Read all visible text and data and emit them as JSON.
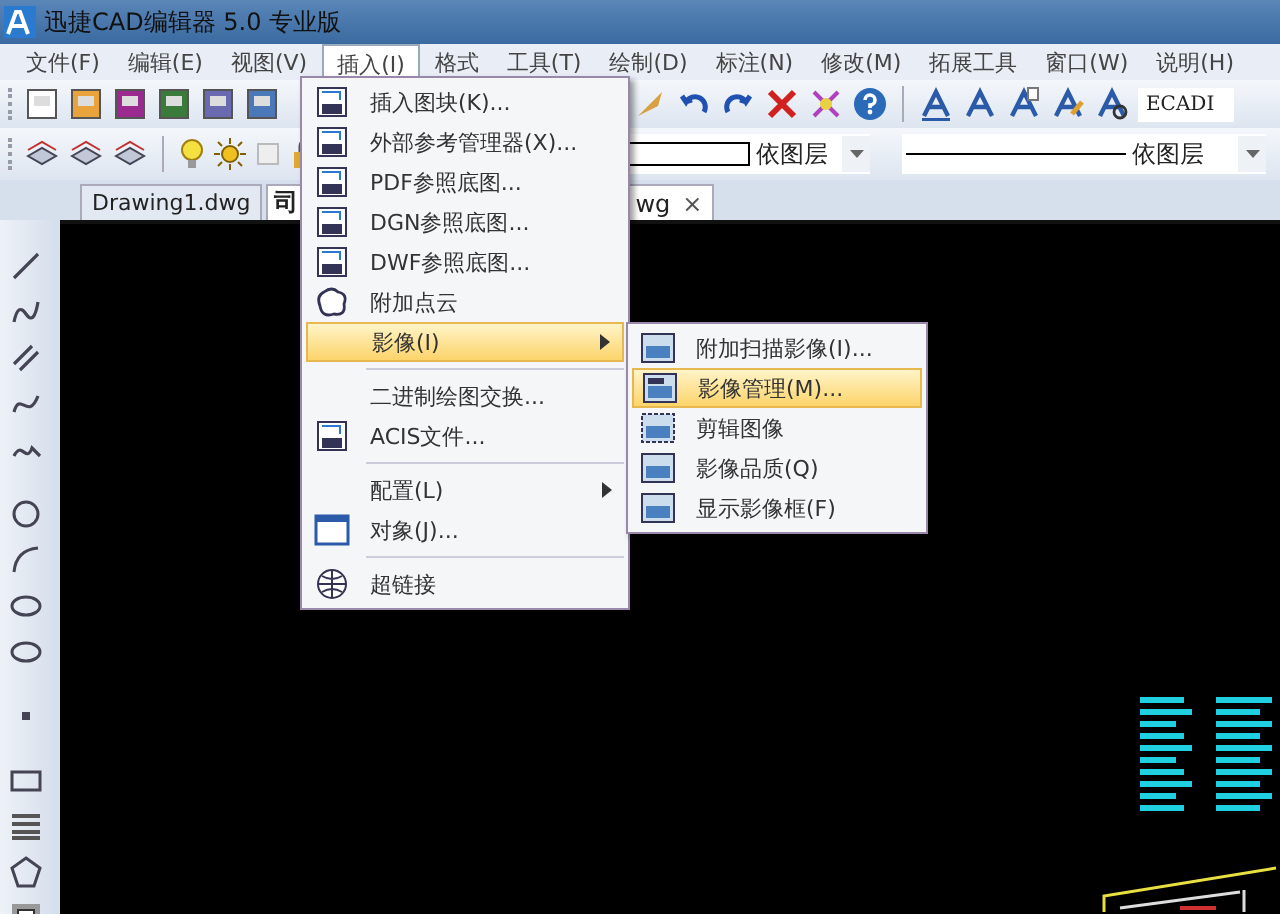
{
  "window": {
    "title": "迅捷CAD编辑器 5.0 专业版"
  },
  "menu_bar": [
    {
      "label": "文件(F)",
      "selected": false
    },
    {
      "label": "编辑(E)",
      "selected": false
    },
    {
      "label": "视图(V)",
      "selected": false
    },
    {
      "label": "插入(I)",
      "selected": true
    },
    {
      "label": "格式",
      "selected": false
    },
    {
      "label": "工具(T)",
      "selected": false
    },
    {
      "label": "绘制(D)",
      "selected": false
    },
    {
      "label": "标注(N)",
      "selected": false
    },
    {
      "label": "修改(M)",
      "selected": false
    },
    {
      "label": "拓展工具",
      "selected": false
    },
    {
      "label": "窗口(W)",
      "selected": false
    },
    {
      "label": "说明(H)",
      "selected": false
    }
  ],
  "toolbar": {
    "text_style_field": "ECADI"
  },
  "properties_bar": {
    "color_combo": "依图层",
    "linetype_combo": "依图层"
  },
  "tabs": [
    {
      "label": "Drawing1.dwg",
      "selected": false
    },
    {
      "label": "司",
      "label_tail": "wg",
      "selected": true,
      "close": "×"
    }
  ],
  "insert_menu": [
    {
      "kind": "item",
      "label": "插入图块(K)...",
      "selected": false,
      "submenu": false
    },
    {
      "kind": "item",
      "label": "外部参考管理器(X)...",
      "selected": false,
      "submenu": false
    },
    {
      "kind": "item",
      "label": "PDF参照底图...",
      "selected": false,
      "submenu": false
    },
    {
      "kind": "item",
      "label": "DGN参照底图...",
      "selected": false,
      "submenu": false
    },
    {
      "kind": "item",
      "label": "DWF参照底图...",
      "selected": false,
      "submenu": false
    },
    {
      "kind": "item",
      "label": "附加点云",
      "selected": false,
      "submenu": false
    },
    {
      "kind": "item",
      "label": "影像(I)",
      "selected": true,
      "submenu": true
    },
    {
      "kind": "separator"
    },
    {
      "kind": "item",
      "label": "二进制绘图交换...",
      "selected": false,
      "submenu": false
    },
    {
      "kind": "item",
      "label": "ACIS文件...",
      "selected": false,
      "submenu": false
    },
    {
      "kind": "separator"
    },
    {
      "kind": "item",
      "label": "配置(L)",
      "selected": false,
      "submenu": true
    },
    {
      "kind": "item",
      "label": "对象(J)...",
      "selected": false,
      "submenu": false
    },
    {
      "kind": "separator"
    },
    {
      "kind": "item",
      "label": "超链接",
      "selected": false,
      "submenu": false
    }
  ],
  "image_submenu": [
    {
      "label": "附加扫描影像(I)...",
      "selected": false
    },
    {
      "label": "影像管理(M)...",
      "selected": true
    },
    {
      "label": "剪辑图像",
      "selected": false
    },
    {
      "label": "影像品质(Q)",
      "selected": false
    },
    {
      "label": "显示影像框(F)",
      "selected": false
    }
  ]
}
